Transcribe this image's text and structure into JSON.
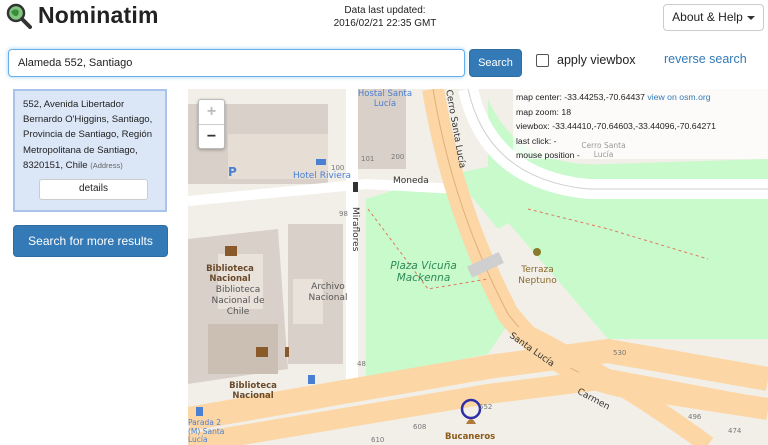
{
  "header": {
    "app_name": "Nominatim",
    "data_updated_label": "Data last updated:",
    "data_updated_value": "2016/02/21 22:35 GMT",
    "about_button": "About & Help"
  },
  "search": {
    "query": "Alameda 552, Santiago",
    "button": "Search",
    "viewbox_label": "apply viewbox",
    "reverse_link": "reverse search"
  },
  "result": {
    "address": "552, Avenida Libertador Bernardo O'Higgins, Santiago, Provincia de Santiago, Región Metropolitana de Santiago, 8320151, Chile",
    "type": "(Address)",
    "details_button": "details"
  },
  "more_results_button": "Search for more results",
  "map": {
    "zoom_in": "+",
    "zoom_out": "−",
    "info": {
      "center_label": "map center: -33.44253,-70.64437",
      "center_link": "view on osm.org",
      "zoom_label": "map zoom: 18",
      "viewbox_label": "viewbox: -33.44410,-70.64603,-33.44096,-70.64271",
      "last_click": "last click: -",
      "mouse_position": "mouse position -"
    },
    "labels": {
      "hostal": "Hostal Santa Lucía",
      "hotel": "Hotel Riviera",
      "cerro_street": "Cerro Santa Lucía",
      "cerro_place": "Cerro Santa Lucía",
      "moneda": "Moneda",
      "miraflores": "Miraflores",
      "plaza": "Plaza Vicuña Mackenna",
      "terraza": "Terraza Neptuno",
      "biblioteca1": "Biblioteca Nacional",
      "biblioteca2": "Biblioteca Nacional de Chile",
      "archivo": "Archivo Nacional",
      "biblioteca3": "Biblioteca Nacional",
      "santa_lucia_street": "Santa Lucía",
      "carmen": "Carmen",
      "bucaneros": "Bucaneros",
      "parada": "Parada 2 (M) Santa Lucía",
      "hn_100": "100",
      "hn_101": "101",
      "hn_200": "200",
      "hn_98": "98",
      "hn_48": "48",
      "hn_530": "530",
      "hn_608": "608",
      "hn_610": "610",
      "hn_496": "496",
      "hn_474": "474",
      "hn_552": "552",
      "parking": "P"
    }
  },
  "colors": {
    "accent": "#337ab7",
    "result_bg": "#dbe6f7",
    "park": "#c8facc",
    "road_major": "#fcd6a4",
    "building": "#d9d0c9"
  }
}
